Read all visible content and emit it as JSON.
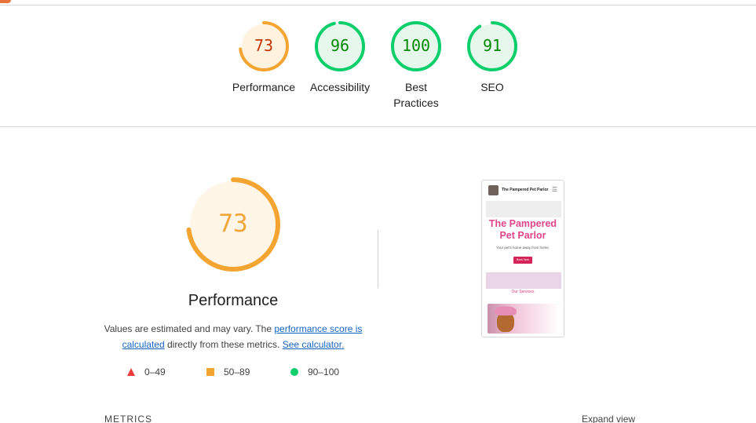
{
  "categories": [
    {
      "score": "73",
      "label": "Performance",
      "fraction": 0.73,
      "color": "#c33300",
      "ring": "#f4a430",
      "fill": "#fff3e0"
    },
    {
      "score": "96",
      "label": "Accessibility",
      "fraction": 0.96,
      "color": "#008800",
      "ring": "#0cce6b",
      "fill": "#e6f7ec"
    },
    {
      "score": "100",
      "label_line1": "Best",
      "label_line2": "Practices",
      "fraction": 1.0,
      "color": "#008800",
      "ring": "#0cce6b",
      "fill": "#e6f7ec"
    },
    {
      "score": "91",
      "label": "SEO",
      "fraction": 0.91,
      "color": "#008800",
      "ring": "#0cce6b",
      "fill": "#e6f7ec"
    }
  ],
  "performance": {
    "score": "73",
    "fraction": 0.73,
    "title": "Performance",
    "desc_prefix": "Values are estimated and may vary. The ",
    "link_score": "performance score is calculated",
    "desc_middle": " directly from these metrics. ",
    "link_calculator": "See calculator."
  },
  "legend": [
    {
      "range": "0–49",
      "color": "#eb3b3b",
      "shape": "triangle"
    },
    {
      "range": "50–89",
      "color": "#f4a430",
      "shape": "square"
    },
    {
      "range": "90–100",
      "color": "#0cce6b",
      "shape": "circle"
    }
  ],
  "screenshot": {
    "brand": "The Pampered Pet Parlor",
    "hero_line1": "The Pampered",
    "hero_line2": "Pet Parlor",
    "tagline": "Your pet's home away from home.",
    "button": "Book Now",
    "services": "Our Services",
    "menu_icon": "hamburger-icon"
  },
  "footer": {
    "metrics": "METRICS",
    "expand": "Expand view"
  }
}
